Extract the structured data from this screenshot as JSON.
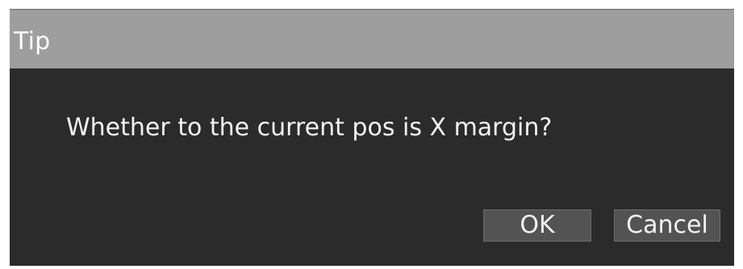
{
  "dialog": {
    "title": "Tip",
    "message": "Whether to the current pos is X margin?",
    "ok_label": "OK",
    "cancel_label": "Cancel"
  },
  "colors": {
    "titlebar": "#9e9e9e",
    "body": "#2b2b2b",
    "button": "#535353",
    "text": "#f2f2f2"
  }
}
